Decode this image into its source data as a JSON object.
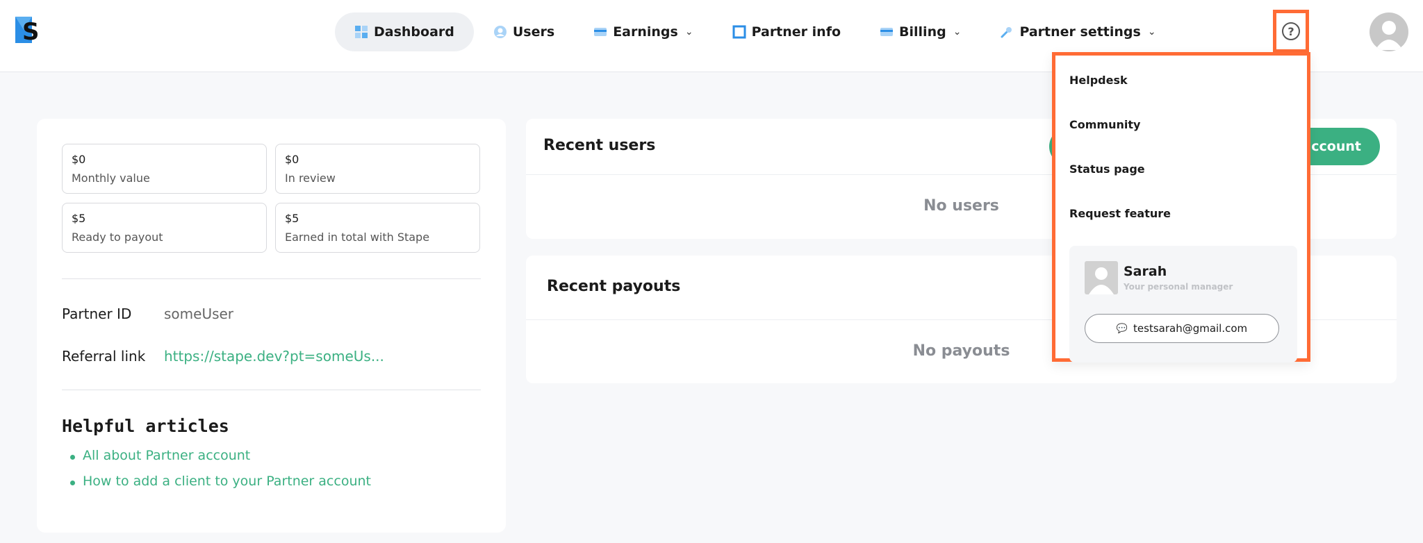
{
  "nav": {
    "items": [
      {
        "label": "Dashboard",
        "icon": "dashboard-grid-icon",
        "active": true
      },
      {
        "label": "Users",
        "icon": "user-circle-icon"
      },
      {
        "label": "Earnings",
        "icon": "credit-card-icon",
        "dropdown": true
      },
      {
        "label": "Partner info",
        "icon": "square-outline-icon"
      },
      {
        "label": "Billing",
        "icon": "credit-card-icon",
        "dropdown": true
      },
      {
        "label": "Partner settings",
        "icon": "wrench-icon",
        "dropdown": true
      }
    ]
  },
  "stats": [
    {
      "value": "$0",
      "label": "Monthly value"
    },
    {
      "value": "$0",
      "label": "In review"
    },
    {
      "value": "$5",
      "label": "Ready to payout"
    },
    {
      "value": "$5",
      "label": "Earned in total with Stape"
    }
  ],
  "partner": {
    "id_label": "Partner ID",
    "id_value": "someUser",
    "referral_label": "Referral link",
    "referral_value": "https://stape.dev?pt=someUs..."
  },
  "articles": {
    "title": "Helpful articles",
    "items": [
      "All about Partner account",
      "How to add a client to your Partner account"
    ]
  },
  "recent_users": {
    "title": "Recent users",
    "empty": "No users",
    "button": "account"
  },
  "recent_payouts": {
    "title": "Recent payouts",
    "empty": "No payouts"
  },
  "help_menu": {
    "items": [
      "Helpdesk",
      "Community",
      "Status page",
      "Request feature"
    ],
    "manager": {
      "name": "Sarah",
      "role": "Your personal manager",
      "email": "testsarah@gmail.com"
    }
  },
  "colors": {
    "accent": "#3bb082",
    "highlight": "#ff6b35"
  }
}
